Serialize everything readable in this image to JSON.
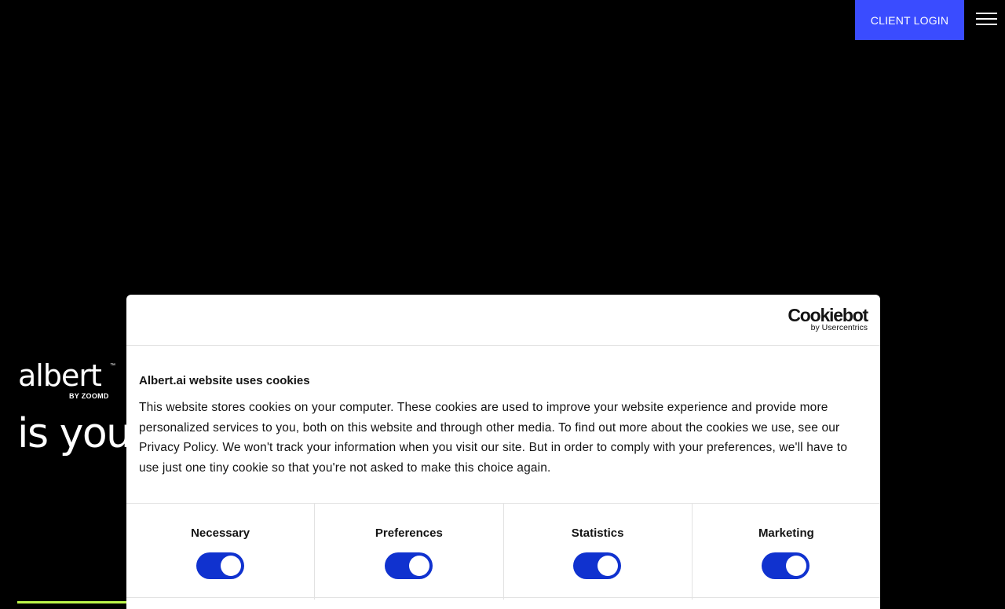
{
  "header": {
    "client_login_label": "CLIENT LOGIN",
    "menu_icon": "hamburger-menu-icon"
  },
  "logo": {
    "wordmark": "albert",
    "tm": "™",
    "byline": "BY ZOOMD"
  },
  "hero": {
    "partial_text": "is your"
  },
  "cookie_dialog": {
    "brand": {
      "name": "Cookiebot",
      "by": "by Usercentrics"
    },
    "title": "Albert.ai website uses cookies",
    "body": "This website stores cookies on your computer. These cookies are used to improve your website experience and provide more personalized services to you, both on this website and through other media. To find out more about the cookies we use, see our Privacy Policy. We won't track your information when you visit our site. But in order to comply with your preferences, we'll have to use just one tiny cookie so that you're not asked to make this choice again.",
    "toggles": [
      {
        "label": "Necessary",
        "enabled": true
      },
      {
        "label": "Preferences",
        "enabled": true
      },
      {
        "label": "Statistics",
        "enabled": true
      },
      {
        "label": "Marketing",
        "enabled": true
      }
    ]
  },
  "colors": {
    "background": "#000000",
    "accent_blue": "#3a4cff",
    "toggle_blue": "#1032cf",
    "green_accent": "#bdf54a"
  }
}
